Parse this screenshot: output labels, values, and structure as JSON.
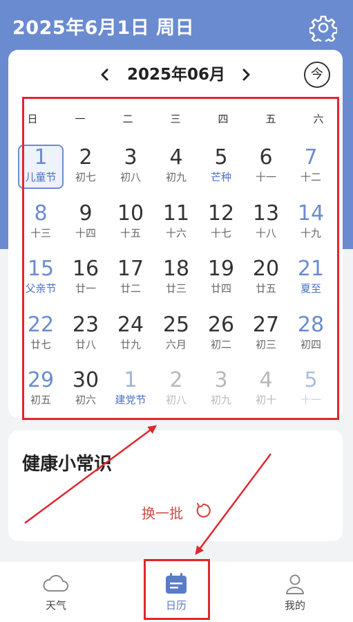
{
  "header": {
    "title": "2025年6月1日 周日"
  },
  "nav": {
    "month": "2025年06月",
    "today_label": "今"
  },
  "weekdays": [
    "日",
    "一",
    "二",
    "三",
    "四",
    "五",
    "六"
  ],
  "days": [
    {
      "d": "1",
      "sub": "儿童节"
    },
    {
      "d": "2",
      "sub": "初七"
    },
    {
      "d": "3",
      "sub": "初八"
    },
    {
      "d": "4",
      "sub": "初九"
    },
    {
      "d": "5",
      "sub": "芒种"
    },
    {
      "d": "6",
      "sub": "十一"
    },
    {
      "d": "7",
      "sub": "十二"
    },
    {
      "d": "8",
      "sub": "十三"
    },
    {
      "d": "9",
      "sub": "十四"
    },
    {
      "d": "10",
      "sub": "十五"
    },
    {
      "d": "11",
      "sub": "十六"
    },
    {
      "d": "12",
      "sub": "十七"
    },
    {
      "d": "13",
      "sub": "十八"
    },
    {
      "d": "14",
      "sub": "十九"
    },
    {
      "d": "15",
      "sub": "父亲节"
    },
    {
      "d": "16",
      "sub": "廿一"
    },
    {
      "d": "17",
      "sub": "廿二"
    },
    {
      "d": "18",
      "sub": "廿三"
    },
    {
      "d": "19",
      "sub": "廿四"
    },
    {
      "d": "20",
      "sub": "廿五"
    },
    {
      "d": "21",
      "sub": "夏至"
    },
    {
      "d": "22",
      "sub": "廿七"
    },
    {
      "d": "23",
      "sub": "廿八"
    },
    {
      "d": "24",
      "sub": "廿九"
    },
    {
      "d": "25",
      "sub": "六月"
    },
    {
      "d": "26",
      "sub": "初二"
    },
    {
      "d": "27",
      "sub": "初三"
    },
    {
      "d": "28",
      "sub": "初四"
    },
    {
      "d": "29",
      "sub": "初五"
    },
    {
      "d": "30",
      "sub": "初六"
    },
    {
      "d": "1",
      "sub": "建党节"
    },
    {
      "d": "2",
      "sub": "初八"
    },
    {
      "d": "3",
      "sub": "初九"
    },
    {
      "d": "4",
      "sub": "初十"
    },
    {
      "d": "5",
      "sub": "十一"
    }
  ],
  "health": {
    "title": "健康小常识",
    "refresh": "换一批"
  },
  "tabs": [
    {
      "label": "天气",
      "icon": "cloud-icon"
    },
    {
      "label": "日历",
      "icon": "calendar-icon",
      "active": true
    },
    {
      "label": "我的",
      "icon": "user-icon"
    }
  ],
  "colors": {
    "header": "#6a8bd0",
    "accent": "#4a72c4",
    "highlight": "#e0262d",
    "refresh": "#d04a45"
  }
}
